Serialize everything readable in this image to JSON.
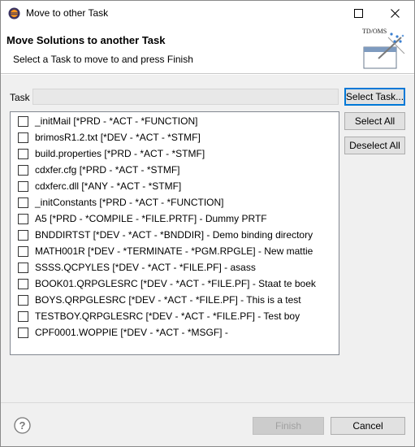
{
  "window": {
    "title": "Move to other Task",
    "app_icon": "eclipse-icon",
    "controls": {
      "maximize": "maximize-icon",
      "close": "close-icon"
    }
  },
  "banner": {
    "title": "Move Solutions to another Task",
    "description": "Select a Task to move to and press Finish",
    "logo_text": "TD/OMS"
  },
  "task": {
    "label": "Task",
    "value": ""
  },
  "buttons": {
    "select_task": "Select Task...",
    "select_all": "Select All",
    "deselect_all": "Deselect All",
    "finish": "Finish",
    "cancel": "Cancel"
  },
  "solutions": [
    {
      "label": "_initMail [*PRD - *ACT - *FUNCTION]",
      "checked": false
    },
    {
      "label": "brimosR1.2.txt [*DEV - *ACT - *STMF]",
      "checked": false
    },
    {
      "label": "build.properties [*PRD - *ACT - *STMF]",
      "checked": false
    },
    {
      "label": "cdxfer.cfg [*PRD - *ACT - *STMF]",
      "checked": false
    },
    {
      "label": "cdxferc.dll [*ANY - *ACT - *STMF]",
      "checked": false
    },
    {
      "label": "_initConstants [*PRD - *ACT - *FUNCTION]",
      "checked": false
    },
    {
      "label": "A5 [*PRD - *COMPILE - *FILE.PRTF] - Dummy PRTF",
      "checked": false
    },
    {
      "label": "BNDDIRTST [*DEV - *ACT - *BNDDIR] - Demo binding directory",
      "checked": false
    },
    {
      "label": "MATH001R [*DEV - *TERMINATE - *PGM.RPGLE] - New mattie",
      "checked": false
    },
    {
      "label": "SSSS.QCPYLES [*DEV - *ACT - *FILE.PF] - asass",
      "checked": false
    },
    {
      "label": "BOOK01.QRPGLESRC [*DEV - *ACT - *FILE.PF] - Staat te boek",
      "checked": false
    },
    {
      "label": "BOYS.QRPGLESRC [*DEV - *ACT - *FILE.PF] - This is a test",
      "checked": false
    },
    {
      "label": "TESTBOY.QRPGLESRC [*DEV - *ACT - *FILE.PF] - Test boy",
      "checked": false
    },
    {
      "label": "CPF0001.WOPPIE [*DEV - *ACT - *MSGF] -",
      "checked": false
    }
  ],
  "footer": {
    "help_icon": "help-icon"
  }
}
